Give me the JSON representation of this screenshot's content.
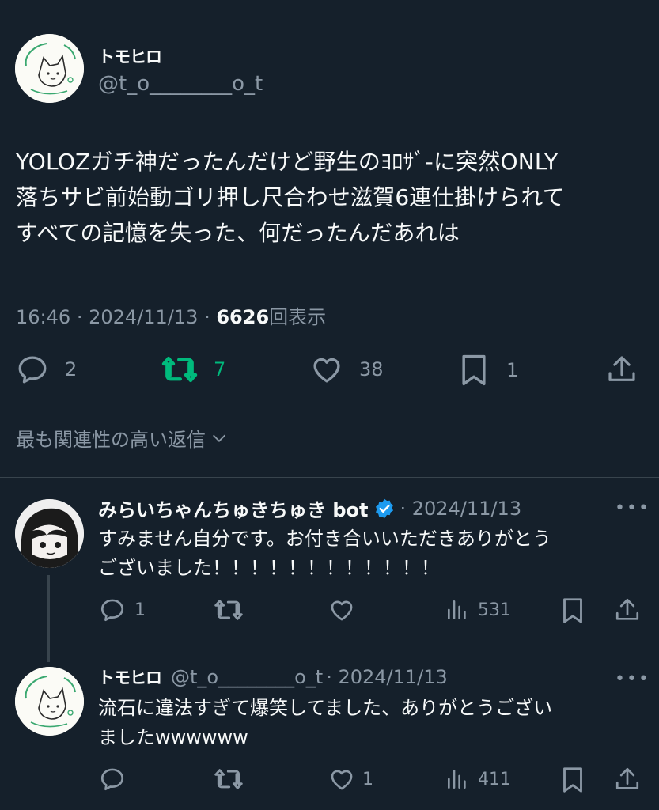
{
  "main_tweet": {
    "display_name": "トモヒロ",
    "handle": "@t_o________o_t",
    "text_lines": [
      "YOLOZガチ神だったんだけど野生のﾖﾛｻﾞ-に突然ONLY",
      "落ちサビ前始動ゴリ押し尺合わせ滋賀6連仕掛けられて",
      "すべての記憶を失った、何だったんだあれは"
    ],
    "time": "16:46",
    "date": "2024/11/13",
    "views_count": "6626",
    "views_label": "回表示",
    "separator": "·",
    "replies": "2",
    "retweets": "7",
    "likes": "38",
    "bookmarks": "1",
    "accent_retweet": "#00ba7c"
  },
  "sort_label": "最も関連性の高い返信",
  "replies": [
    {
      "display_name": "みらいちゃんちゅきちゅき bot",
      "verified": true,
      "date": "· 2024/11/13",
      "text_lines": [
        "すみません自分です。お付き合いいただきありがとう",
        "ございました！！！！！！！！！！！！"
      ],
      "replies": "1",
      "retweets": "",
      "likes": "",
      "views": "531",
      "more": "•••"
    },
    {
      "display_name": "トモヒロ",
      "handle": "@t_o________o_t",
      "date": "· 2024/11/13",
      "text_lines": [
        "流石に違法すぎて爆笑してました、ありがとうござい",
        "ましたwwwwww"
      ],
      "replies": "",
      "retweets": "",
      "likes": "1",
      "views": "411",
      "more": "•••"
    }
  ],
  "colors": {
    "background": "#15202b",
    "text": "#f7f9f9",
    "muted": "#8b98a5",
    "verified": "#1d9bf0"
  }
}
